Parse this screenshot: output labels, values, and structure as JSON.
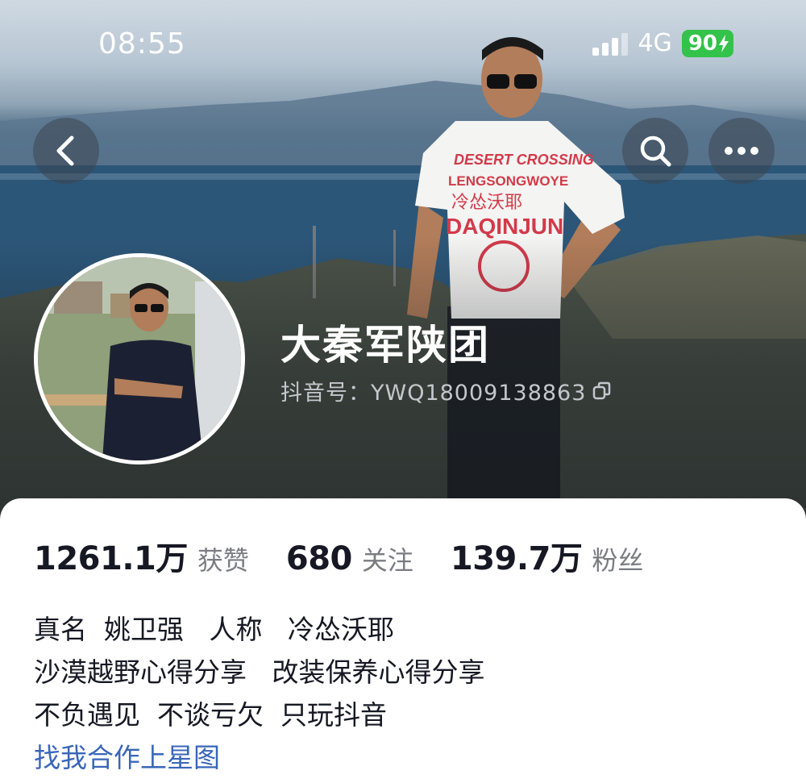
{
  "status_bar": {
    "time": "08:55",
    "network": "4G",
    "battery": "90"
  },
  "colors": {
    "battery_green": "#33c24a",
    "text_primary": "#161823",
    "text_secondary": "#7a7c82",
    "link_blue": "#3a66b8"
  },
  "header": {
    "back_icon": "chevron-left-icon",
    "search_icon": "search-icon",
    "more_icon": "ellipsis-icon"
  },
  "profile": {
    "name": "大秦军陕团",
    "douyin_id": "抖音号：YWQ18009138863",
    "copy_icon": "copy-icon",
    "shirt_text": [
      "DESERT CROSSING",
      "LENGSONGWOYE",
      "冷怂沃耶",
      "DAQINJUN"
    ]
  },
  "stats": [
    {
      "value": "1261.1万",
      "label": "获赞"
    },
    {
      "value": "680",
      "label": "关注"
    },
    {
      "value": "139.7万",
      "label": "粉丝"
    }
  ],
  "bio": {
    "lines": [
      "真名  姚卫强   人称   冷怂沃耶",
      "沙漠越野心得分享   改装保养心得分享",
      "不负遇见  不谈亏欠  只玩抖音"
    ],
    "link": "找我合作上星图"
  }
}
